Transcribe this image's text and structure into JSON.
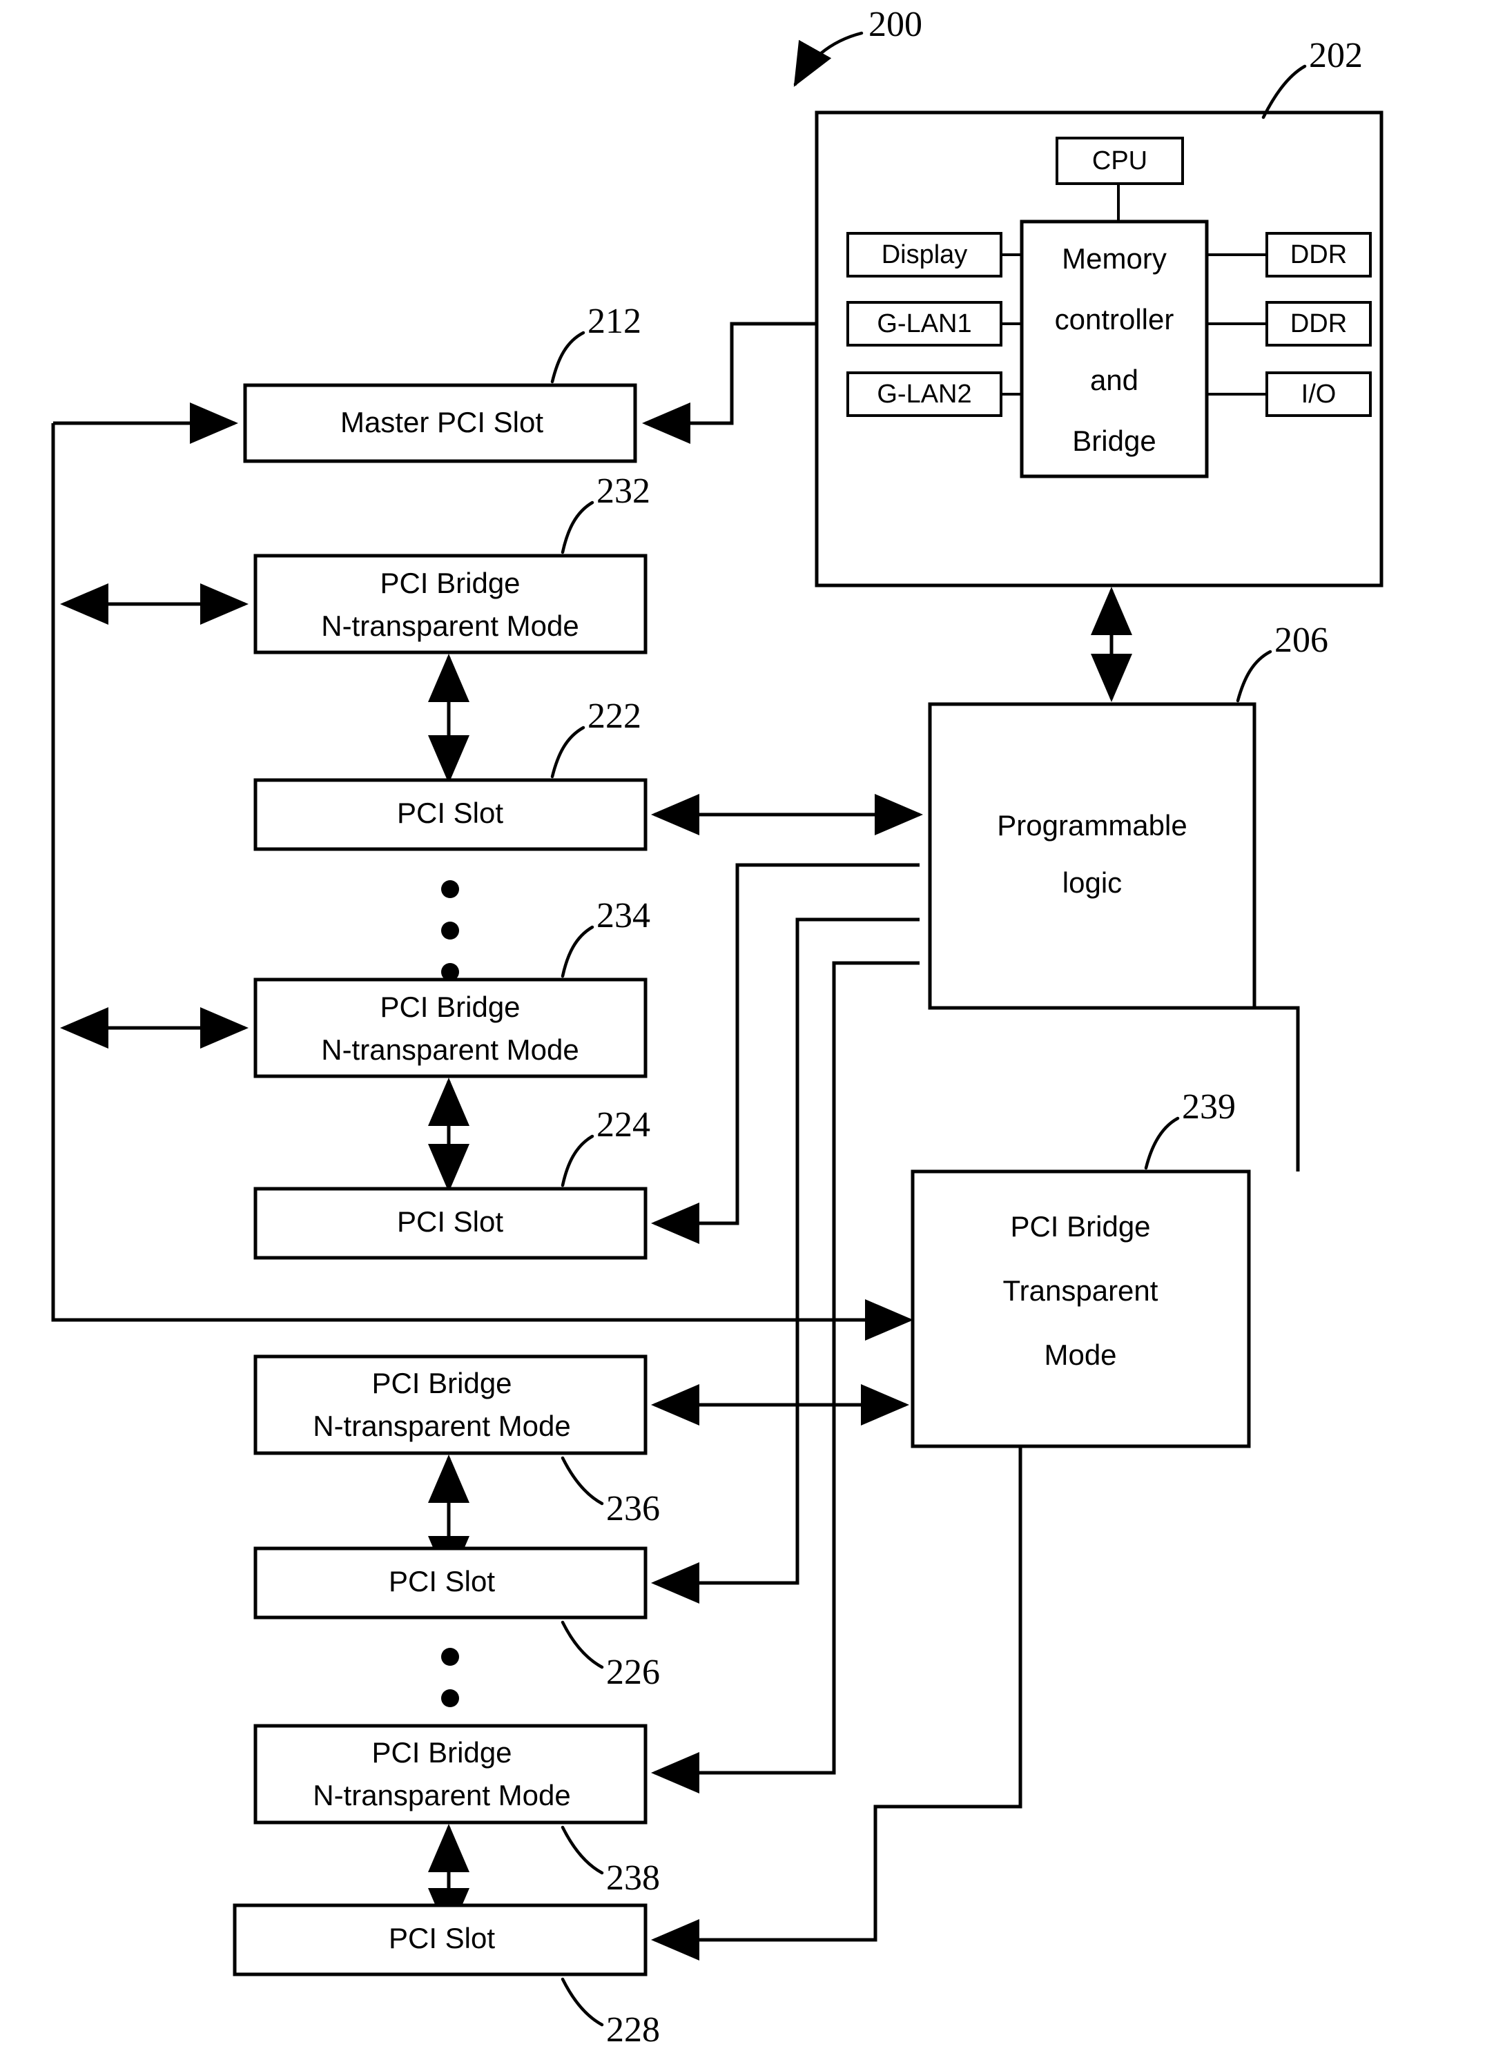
{
  "figure": {
    "id": "200",
    "type": "patent-block-diagram",
    "title_ref": "200"
  },
  "reference_numerals": {
    "figure": "200",
    "system_box": "202",
    "master_pci_slot": "212",
    "programmable_logic": "206",
    "bridge_232": "232",
    "slot_222": "222",
    "bridge_234": "234",
    "slot_224": "224",
    "bridge_236": "236",
    "slot_226": "226",
    "bridge_238": "238",
    "slot_228": "228",
    "bridge_transparent": "239"
  },
  "system_box": {
    "ref": "202",
    "cpu": "CPU",
    "memory_controller": "Memory controller and Bridge",
    "memory_controller_lines": [
      "Memory",
      "controller",
      "and",
      "Bridge"
    ],
    "left_ports": [
      "Display",
      "G-LAN1",
      "G-LAN2"
    ],
    "right_ports": [
      "DDR",
      "DDR",
      "I/O"
    ]
  },
  "blocks": {
    "master_pci_slot": {
      "label": "Master PCI Slot",
      "ref": "212"
    },
    "programmable_logic": {
      "label": "Programmable logic",
      "lines": [
        "Programmable",
        "logic"
      ],
      "ref": "206"
    },
    "pci_bridge_transparent": {
      "label": "PCI Bridge Transparent Mode",
      "lines": [
        "PCI Bridge",
        "Transparent",
        "Mode"
      ],
      "ref": "239"
    },
    "bridge_232": {
      "lines": [
        "PCI Bridge",
        "N-transparent Mode"
      ],
      "ref": "232"
    },
    "slot_222": {
      "label": "PCI Slot",
      "ref": "222"
    },
    "bridge_234": {
      "lines": [
        "PCI Bridge",
        "N-transparent Mode"
      ],
      "ref": "234"
    },
    "slot_224": {
      "label": "PCI Slot",
      "ref": "224"
    },
    "bridge_236": {
      "lines": [
        "PCI Bridge",
        "N-transparent Mode"
      ],
      "ref": "236"
    },
    "slot_226": {
      "label": "PCI Slot",
      "ref": "226"
    },
    "bridge_238": {
      "lines": [
        "PCI Bridge",
        "N-transparent Mode"
      ],
      "ref": "238"
    },
    "slot_228": {
      "label": "PCI Slot",
      "ref": "228"
    }
  },
  "labels": {
    "cpu": "CPU",
    "display": "Display",
    "glan1": "G-LAN1",
    "glan2": "G-LAN2",
    "ddr1": "DDR",
    "ddr2": "DDR",
    "io": "I/O",
    "mem_l1": "Memory",
    "mem_l2": "controller",
    "mem_l3": "and",
    "mem_l4": "Bridge",
    "master_pci_slot": "Master PCI Slot",
    "pci_bridge": "PCI Bridge",
    "n_transparent_mode": "N-transparent Mode",
    "pci_slot": "PCI Slot",
    "prog_l1": "Programmable",
    "prog_l2": "logic",
    "trans_l1": "PCI Bridge",
    "trans_l2": "Transparent",
    "trans_l3": "Mode"
  },
  "colors": {
    "stroke": "#000000",
    "background": "#ffffff"
  }
}
